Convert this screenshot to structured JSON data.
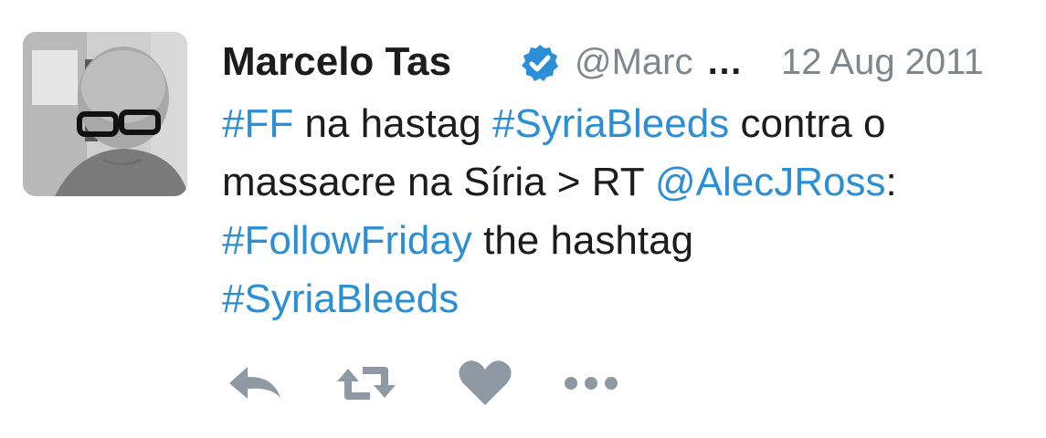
{
  "tweet": {
    "author": {
      "name": "Marcelo Tas",
      "handle": "@Marc",
      "handle_truncation": "…",
      "verified": true,
      "avatar_icon": "user-avatar-photo"
    },
    "date": "12 Aug 2011",
    "text": {
      "line1": {
        "tag_ff": "#FF",
        "t1": " na hastag ",
        "tag_syria": "#SyriaBleeds",
        "t2": " contra o"
      },
      "line2": {
        "t1": "massacre na Síria > RT ",
        "mention": "@AlecJRoss",
        "t2": ":"
      },
      "line3": {
        "tag_follow": "#FollowFriday",
        "t1": " the hashtag"
      },
      "line4": {
        "tag_syria": "#SyriaBleeds"
      }
    },
    "actions": [
      {
        "icon": "reply-icon"
      },
      {
        "icon": "retweet-icon"
      },
      {
        "icon": "like-heart-icon"
      },
      {
        "icon": "more-options-icon"
      }
    ]
  },
  "colors": {
    "link": "#2b8fd6",
    "text": "#1c1c1c",
    "muted": "#7f868c",
    "verified_badge": "#2b8fd6",
    "action_icon": "#8f99a3"
  }
}
